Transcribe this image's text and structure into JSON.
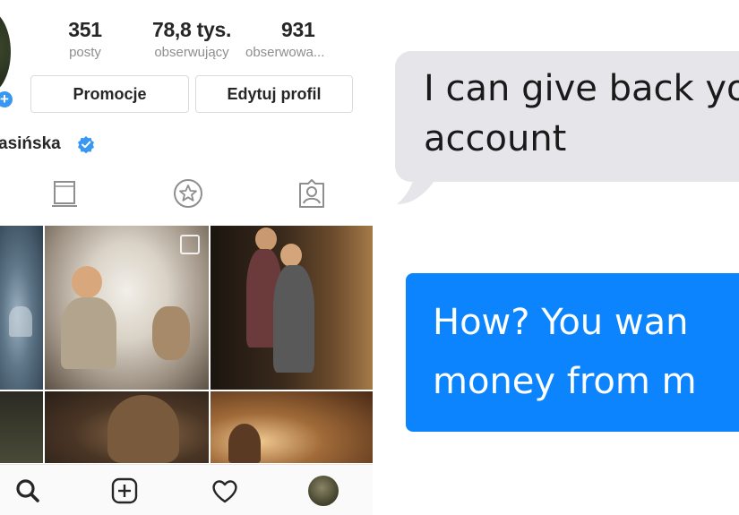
{
  "profile": {
    "stats": [
      {
        "value": "351",
        "label": "posty"
      },
      {
        "value": "78,8 tys.",
        "label": "obserwujący"
      },
      {
        "value": "931",
        "label": "obserwowa..."
      }
    ],
    "buttons": {
      "promo": "Promocje",
      "edit": "Edytuj profil"
    },
    "username": "asińska",
    "verified_color": "#3897f0",
    "tabs": [
      "grid-icon",
      "star-icon",
      "tagged-icon"
    ],
    "bottom_nav": [
      "search-icon",
      "add-icon",
      "heart-icon",
      "profile-avatar"
    ]
  },
  "chat": {
    "received": {
      "text": "I can give back yo\naccount",
      "color": "#e5e5ea"
    },
    "sent": {
      "text": "How? You wan\nmoney from m",
      "color": "#0b84fd"
    }
  }
}
